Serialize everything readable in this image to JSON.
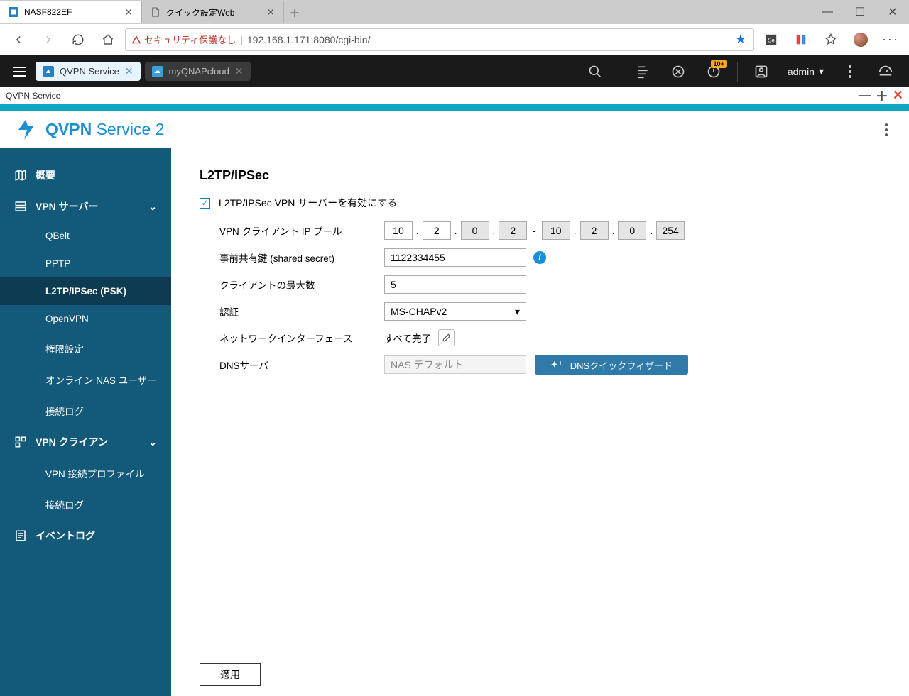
{
  "browser": {
    "tabs": [
      {
        "title": "NASF822EF",
        "active": true
      },
      {
        "title": "クイック設定Web",
        "active": false
      }
    ],
    "security_warning": "セキュリティ保護なし",
    "url": "192.168.1.171:8080/cgi-bin/"
  },
  "qnap_top": {
    "tabs": [
      {
        "title": "QVPN Service",
        "active": true
      },
      {
        "title": "myQNAPcloud",
        "active": false
      }
    ],
    "notif_badge": "10+",
    "user": "admin"
  },
  "subwindow": {
    "title": "QVPN Service"
  },
  "app": {
    "title_bold": "QVPN",
    "title_rest": " Service 2"
  },
  "sidebar": {
    "overview": "概要",
    "vpn_server": "VPN サーバー",
    "qbelt": "QBelt",
    "pptp": "PPTP",
    "l2tp": "L2TP/IPSec (PSK)",
    "openvpn": "OpenVPN",
    "privilege": "権限設定",
    "online_users": "オンライン NAS ユーザー",
    "conn_log1": "接続ログ",
    "vpn_client": "VPN クライアン",
    "vpn_profile": "VPN 接続プロファイル",
    "conn_log2": "接続ログ",
    "event_log": "イベントログ"
  },
  "page": {
    "title": "L2TP/IPSec",
    "enable_label": "L2TP/IPSec VPN サーバーを有効にする",
    "ip_pool_label": "VPN クライアント IP プール",
    "ip_start": [
      "10",
      "2",
      "0",
      "2"
    ],
    "ip_dash": "-",
    "ip_end": [
      "10",
      "2",
      "0",
      "254"
    ],
    "psk_label": "事前共有鍵 (shared secret)",
    "psk_value": "1122334455",
    "max_clients_label": "クライアントの最大数",
    "max_clients_value": "5",
    "auth_label": "認証",
    "auth_value": "MS-CHAPv2",
    "iface_label": "ネットワークインターフェース",
    "iface_value": "すべて完了",
    "dns_label": "DNSサーバ",
    "dns_placeholder": "NAS デフォルト",
    "wizard_btn": "DNSクイックウィザード",
    "apply": "適用"
  }
}
